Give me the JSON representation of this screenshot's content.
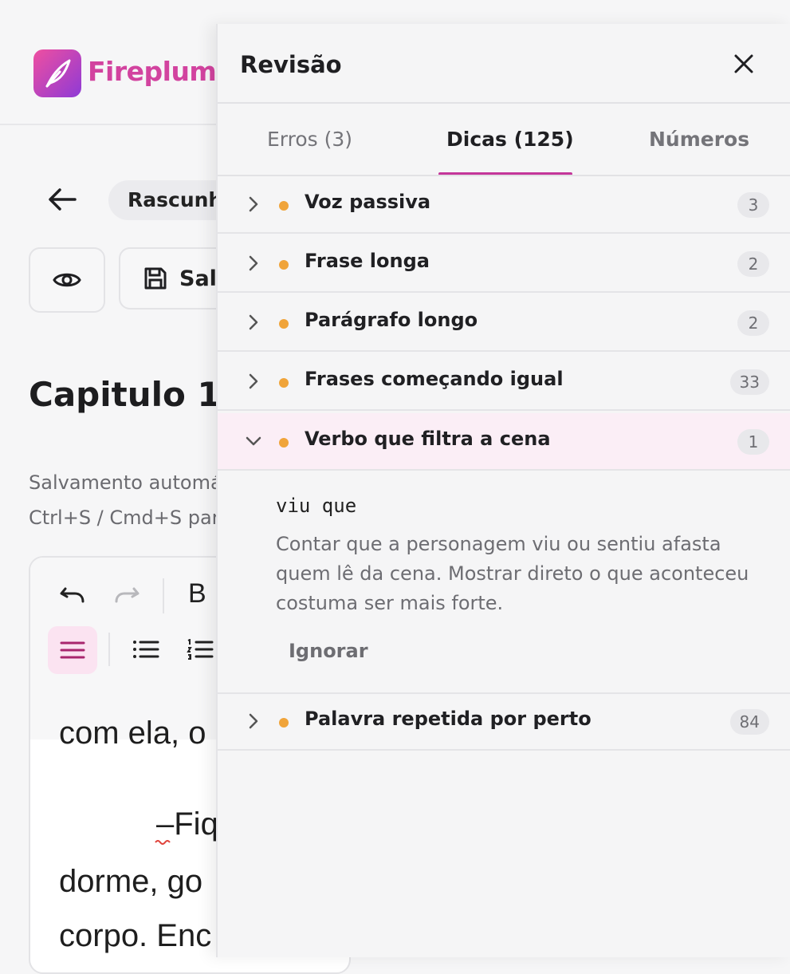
{
  "app": {
    "brand": "Fireplume",
    "draft_chip": "Rascunho",
    "save_label": "Salvar",
    "chapter_title": "Capitulo 1",
    "autosave_line1": "Salvamento automático",
    "autosave_line2": "Ctrl+S / Cmd+S para salvar",
    "editor_lines": [
      "com ela, o",
      "–Fiq",
      "dorme,  go",
      "corpo. Enc"
    ]
  },
  "panel": {
    "title": "Revisão",
    "tabs": [
      {
        "label": "Erros (3)",
        "active": false
      },
      {
        "label": "Dicas (125)",
        "active": true
      },
      {
        "label": "Números",
        "active": false
      }
    ],
    "items": [
      {
        "label": "Voz passiva",
        "count": "3",
        "expanded": false
      },
      {
        "label": "Frase longa",
        "count": "2",
        "expanded": false
      },
      {
        "label": "Parágrafo longo",
        "count": "2",
        "expanded": false
      },
      {
        "label": "Frases começando igual",
        "count": "33",
        "expanded": false
      },
      {
        "label": "Verbo que filtra a cena",
        "count": "1",
        "expanded": true
      },
      {
        "label": "Palavra repetida por perto",
        "count": "84",
        "expanded": false
      }
    ],
    "detail": {
      "word": "viu que",
      "explanation": "Contar que a personagem viu ou sentiu afasta quem lê da cena. Mostrar direto o que aconteceu costuma ser mais forte.",
      "ignore_label": "Ignorar"
    }
  },
  "colors": {
    "accent": "#c4369a",
    "dot": "#f0a43a",
    "active_row_bg": "#fbeef6"
  }
}
